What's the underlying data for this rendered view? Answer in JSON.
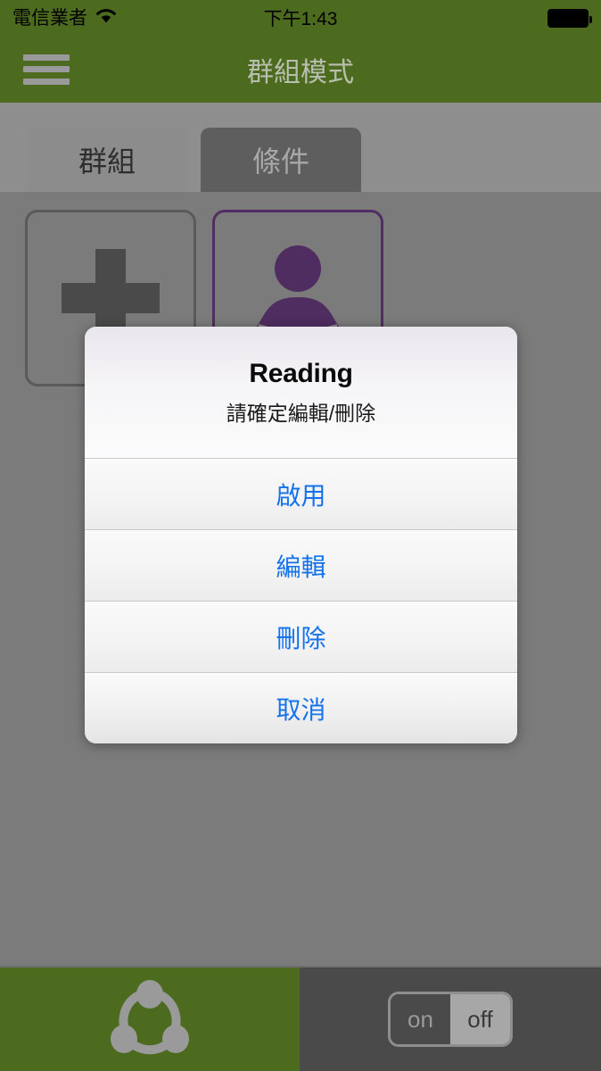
{
  "status_bar": {
    "carrier": "電信業者",
    "wifi_icon": "wifi-icon",
    "time": "下午1:43",
    "battery_icon": "battery-full-icon"
  },
  "nav_bar": {
    "menu_icon": "hamburger-menu-icon",
    "title": "群組模式"
  },
  "tabs": [
    {
      "label": "群組",
      "name": "tab-group",
      "active": true
    },
    {
      "label": "條件",
      "name": "tab-condition",
      "active": false
    }
  ],
  "content": {
    "cards": [
      {
        "name": "add-group-card",
        "icon": "plus-icon",
        "label": ""
      },
      {
        "name": "reading-group-card",
        "icon": "person-reading-icon",
        "label": ""
      }
    ]
  },
  "dialog": {
    "title": "Reading",
    "subtitle": "請確定編輯/刪除",
    "buttons": [
      {
        "label": "啟用",
        "name": "enable-button"
      },
      {
        "label": "編輯",
        "name": "edit-button"
      },
      {
        "label": "刪除",
        "name": "delete-button"
      },
      {
        "label": "取消",
        "name": "cancel-button"
      }
    ]
  },
  "bottom_bar": {
    "share_icon": "share-network-icon",
    "toggle": {
      "on_label": "on",
      "off_label": "off",
      "selected": "off"
    }
  },
  "colors": {
    "brand_green": "#4c6b1f",
    "page_background": "#7b7b7b",
    "tab_bar_background": "#8e8e8e",
    "accent_blue": "#1472ea",
    "purple": "#522d63",
    "bottom_right_background": "#4a4a4a"
  }
}
